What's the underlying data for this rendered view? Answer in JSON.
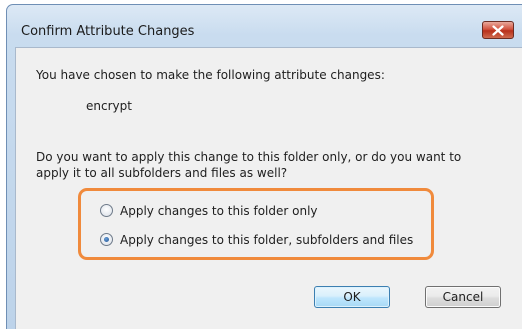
{
  "dialog": {
    "title": "Confirm Attribute Changes",
    "intro": "You have chosen to make the following attribute changes:",
    "change": "encrypt",
    "question_line1": "Do you want to apply this change to this folder only, or do you want to",
    "question_line2": "apply it to all subfolders and files as well?",
    "options": [
      {
        "label": "Apply changes to this folder only",
        "selected": false
      },
      {
        "label": "Apply changes to this folder, subfolders and files",
        "selected": true
      }
    ],
    "ok_label": "OK",
    "cancel_label": "Cancel",
    "highlight_color": "#f08a3c",
    "close_icon": "close-icon"
  }
}
